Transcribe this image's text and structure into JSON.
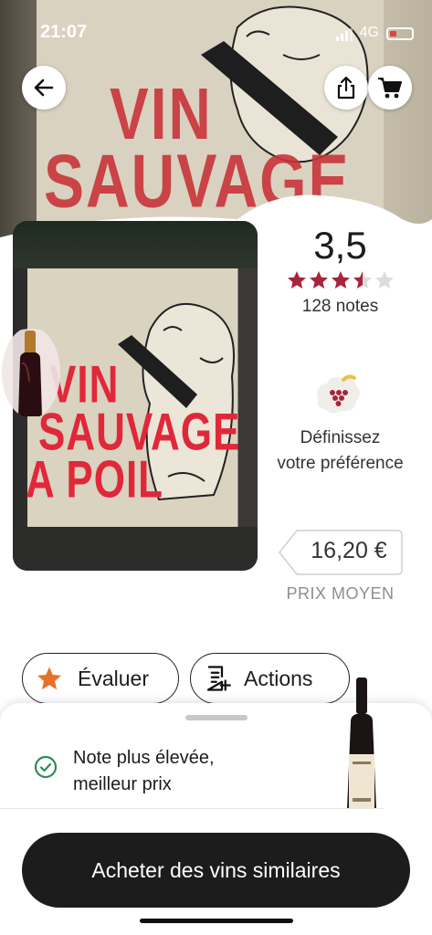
{
  "status_bar": {
    "time": "21:07",
    "network": "4G"
  },
  "hero": {
    "label_line1": "VIN",
    "label_line2": "SAUVAGE"
  },
  "photo": {
    "line1": "VIN",
    "line2": "SAUVAGE",
    "line3": "A POIL"
  },
  "rating": {
    "value": "3,5",
    "stars": 3.5,
    "count_text": "128 notes"
  },
  "preference": {
    "line1": "Définissez",
    "line2": "votre préférence"
  },
  "price": {
    "value": "16,20 €",
    "label": "PRIX MOYEN"
  },
  "actions": {
    "rate_label": "Évaluer",
    "actions_label": "Actions"
  },
  "sheet": {
    "note_line1": "Note plus élevée,",
    "note_line2": "meilleur prix"
  },
  "cta": {
    "label": "Acheter des vins similaires"
  },
  "colors": {
    "accent_red": "#a8243c",
    "star_orange": "#e8712a",
    "check_green": "#2e8b57"
  },
  "icons": [
    "back-arrow-icon",
    "share-icon",
    "cart-icon",
    "star-icon",
    "actions-list-icon",
    "check-circle-icon",
    "grape-preference-icon"
  ]
}
